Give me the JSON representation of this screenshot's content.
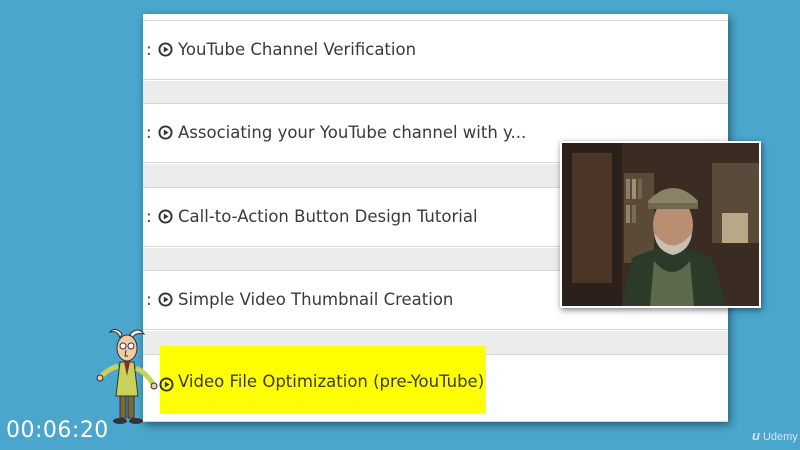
{
  "lessons": [
    {
      "colon": ":",
      "title": "YouTube Channel Verification"
    },
    {
      "colon": ":",
      "title": "Associating your YouTube channel with y..."
    },
    {
      "colon": ":",
      "title": "Call-to-Action Button Design Tutorial"
    },
    {
      "colon": ":",
      "title": "Simple Video Thumbnail Creation"
    },
    {
      "colon": "",
      "title": "Video File Optimization (pre-YouTube)",
      "highlighted": true
    }
  ],
  "highlight_color": "#ffff00",
  "timer": "00:06:20",
  "logo_text": "Udemy",
  "logo_mark": "u",
  "icons": {
    "play": "play-circle-icon"
  },
  "background_color": "#4aa6cc"
}
